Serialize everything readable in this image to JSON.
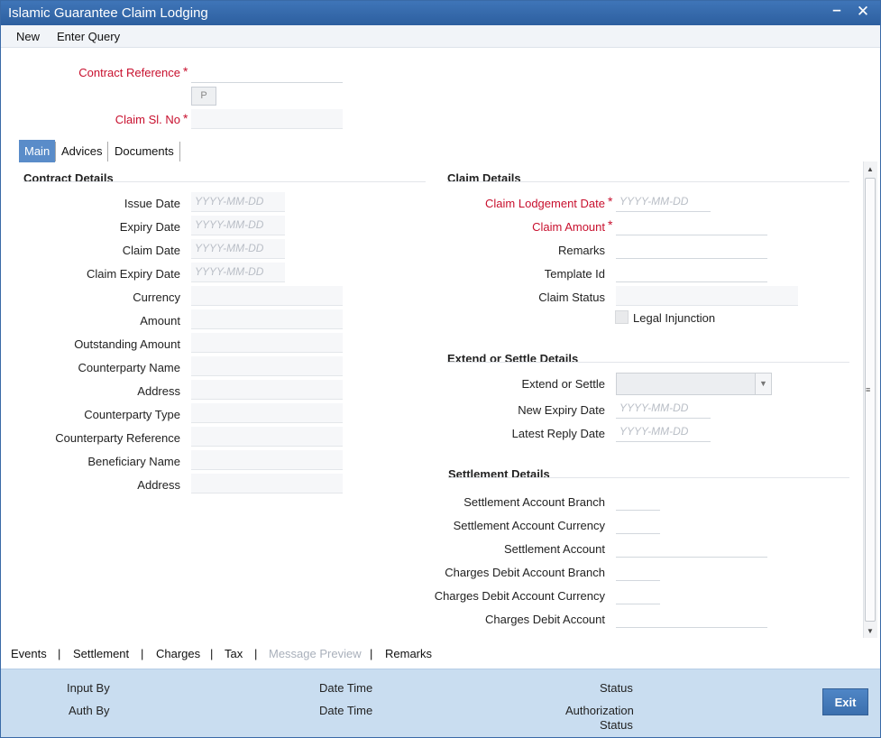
{
  "window": {
    "title": "Islamic Guarantee Claim Lodging"
  },
  "menu": {
    "new": "New",
    "enter_query": "Enter Query"
  },
  "header": {
    "contract_reference_label": "Contract Reference",
    "p_button": "P",
    "claim_sl_no_label": "Claim Sl. No",
    "required_mark": "*"
  },
  "tabs": [
    {
      "label": "Main",
      "active": true
    },
    {
      "label": "Advices",
      "active": false
    },
    {
      "label": "Documents",
      "active": false
    }
  ],
  "contract_details": {
    "title": "Contract Details",
    "date_placeholder": "YYYY-MM-DD",
    "fields": [
      "Issue Date",
      "Expiry Date",
      "Claim Date",
      "Claim Expiry Date",
      "Currency",
      "Amount",
      "Outstanding Amount",
      "Counterparty Name",
      "Address",
      "Counterparty Type",
      "Counterparty Reference",
      "Beneficiary Name",
      "Address"
    ]
  },
  "claim_details": {
    "title": "Claim Details",
    "claim_lodgement_date": "Claim Lodgement Date",
    "claim_amount": "Claim Amount",
    "remarks": "Remarks",
    "template_id": "Template Id",
    "claim_status": "Claim Status",
    "legal_injunction": "Legal Injunction"
  },
  "extend_settle": {
    "title": "Extend or Settle Details",
    "extend_or_settle": "Extend or Settle",
    "new_expiry_date": "New Expiry Date",
    "latest_reply_date": "Latest Reply Date"
  },
  "settlement": {
    "title": "Settlement Details",
    "fields": [
      "Settlement Account Branch",
      "Settlement Account Currency",
      "Settlement Account",
      "Charges Debit Account Branch",
      "Charges Debit Account Currency",
      "Charges Debit Account"
    ]
  },
  "bottom_links": {
    "events": "Events",
    "settlement": "Settlement",
    "charges": "Charges",
    "tax": "Tax",
    "message_preview": "Message Preview",
    "remarks": "Remarks",
    "separator": "|"
  },
  "footer": {
    "input_by": "Input By",
    "auth_by": "Auth By",
    "date_time_1": "Date Time",
    "date_time_2": "Date Time",
    "status": "Status",
    "authorization": "Authorization",
    "authorization_status": "Status",
    "exit": "Exit"
  }
}
